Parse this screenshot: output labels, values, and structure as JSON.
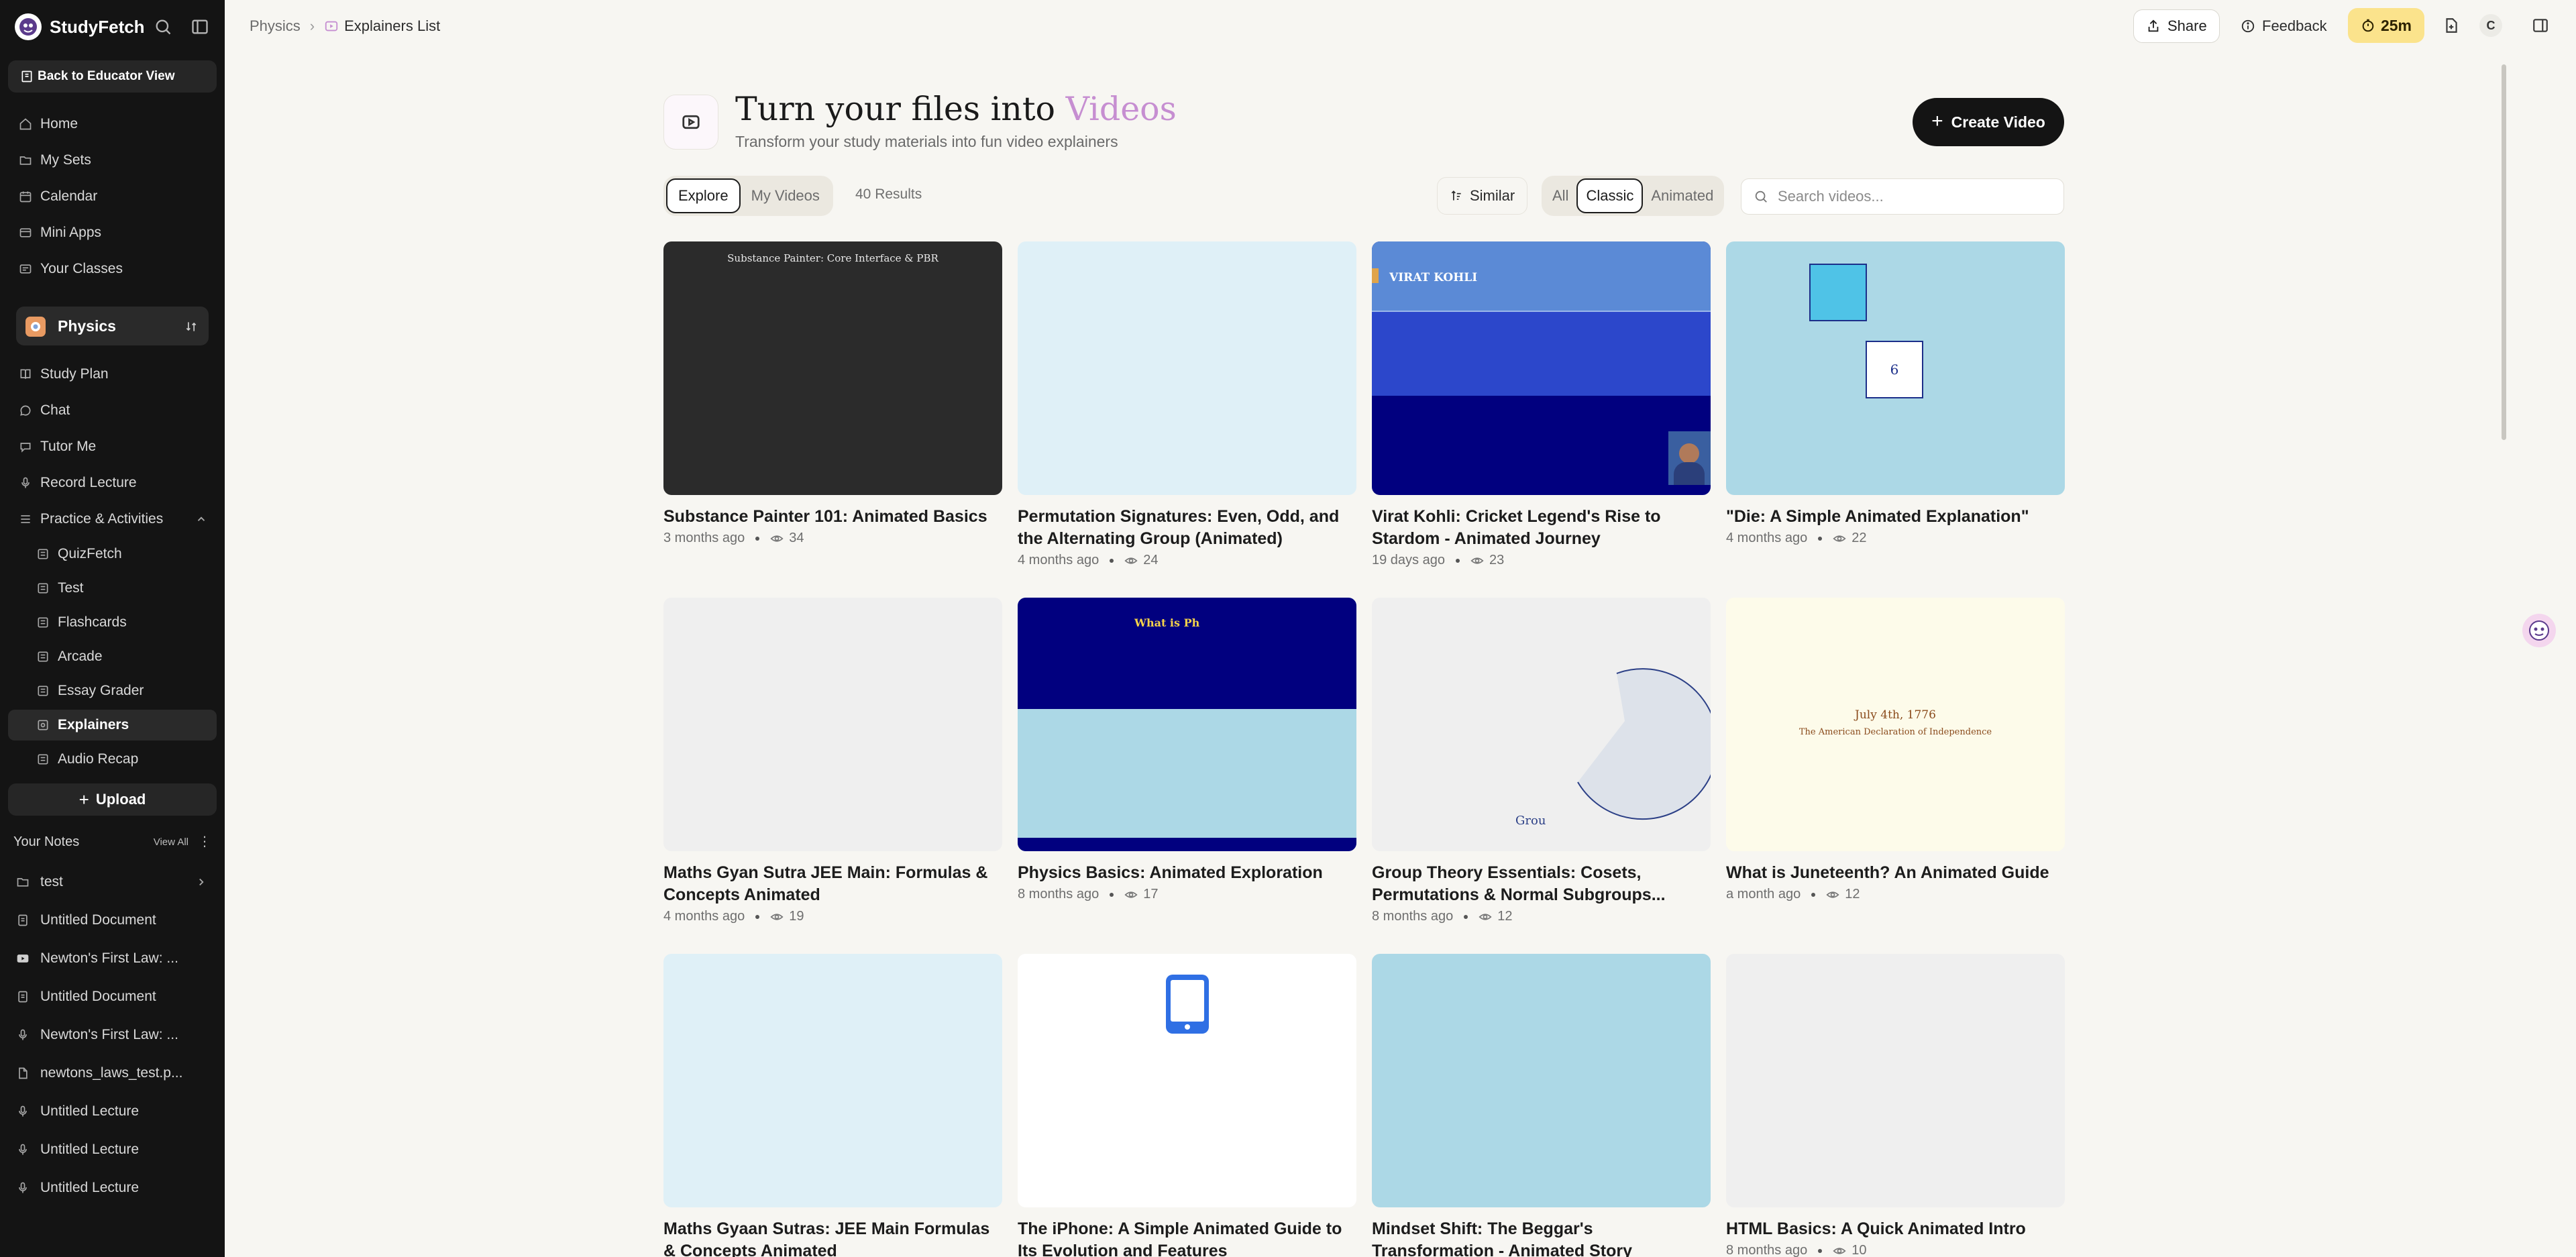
{
  "app": {
    "name": "StudyFetch"
  },
  "sidebar": {
    "back_label": "Back to Educator View",
    "nav": [
      {
        "label": "Home",
        "icon": "home-icon"
      },
      {
        "label": "My Sets",
        "icon": "folder-icon"
      },
      {
        "label": "Calendar",
        "icon": "calendar-icon"
      },
      {
        "label": "Mini Apps",
        "icon": "grid-icon"
      },
      {
        "label": "Your Classes",
        "icon": "layers-icon"
      }
    ],
    "class_name": "Physics",
    "class_nav": [
      {
        "label": "Study Plan",
        "icon": "book-icon"
      },
      {
        "label": "Chat",
        "icon": "chat-icon"
      },
      {
        "label": "Tutor Me",
        "icon": "tutor-icon"
      },
      {
        "label": "Record Lecture",
        "icon": "mic-icon"
      },
      {
        "label": "Practice & Activities",
        "icon": "activities-icon"
      }
    ],
    "practice_items": [
      {
        "label": "QuizFetch",
        "icon": "quiz-icon"
      },
      {
        "label": "Test",
        "icon": "test-icon"
      },
      {
        "label": "Flashcards",
        "icon": "flashcards-icon"
      },
      {
        "label": "Arcade",
        "icon": "arcade-icon"
      },
      {
        "label": "Essay Grader",
        "icon": "essay-icon"
      },
      {
        "label": "Explainers",
        "icon": "explainers-icon",
        "active": true
      },
      {
        "label": "Audio Recap",
        "icon": "audio-icon"
      }
    ],
    "upload_label": "Upload",
    "notes_title": "Your Notes",
    "notes_view_all": "View All",
    "notes": [
      {
        "label": "test",
        "icon": "folder-icon",
        "has_chevron": true
      },
      {
        "label": "Untitled Document",
        "icon": "document-icon"
      },
      {
        "label": "Newton's First Law: ...",
        "icon": "video-icon"
      },
      {
        "label": "Untitled Document",
        "icon": "document-icon"
      },
      {
        "label": "Newton's First Law: ...",
        "icon": "mic-icon"
      },
      {
        "label": "newtons_laws_test.p...",
        "icon": "pdf-icon"
      },
      {
        "label": "Untitled Lecture",
        "icon": "mic-icon"
      },
      {
        "label": "Untitled Lecture",
        "icon": "mic-icon"
      },
      {
        "label": "Untitled Lecture",
        "icon": "mic-icon"
      }
    ]
  },
  "topbar": {
    "breadcrumb": [
      "Physics",
      "Explainers List"
    ],
    "share_label": "Share",
    "feedback_label": "Feedback",
    "timer_label": "25m",
    "avatar_initial": "C"
  },
  "hero": {
    "title_prefix": "Turn your files into",
    "title_accent": "Videos",
    "subtitle": "Transform your study materials into fun video explainers",
    "create_label": "Create Video",
    "accent_color": "#c68ed1"
  },
  "filters": {
    "tabs": [
      {
        "label": "Explore",
        "active": true
      },
      {
        "label": "My Videos",
        "active": false
      }
    ],
    "results": "40 Results",
    "sort_label": "Similar",
    "types": [
      {
        "label": "All",
        "active": false
      },
      {
        "label": "Classic",
        "active": true
      },
      {
        "label": "Animated",
        "active": false
      }
    ],
    "search_placeholder": "Search videos..."
  },
  "videos": [
    {
      "title": "Substance Painter 101: Animated Basics",
      "age": "3 months ago",
      "views": "34",
      "thumb_text": "Substance Painter: Core Interface & PBR"
    },
    {
      "title": "Permutation Signatures: Even, Odd, and the Alternating Group (Animated)",
      "age": "4 months ago",
      "views": "24"
    },
    {
      "title": "Virat Kohli: Cricket Legend's Rise to Stardom - Animated Journey",
      "age": "19 days ago",
      "views": "23",
      "thumb_text": "VIRAT KOHLI"
    },
    {
      "title": "\"Die: A Simple Animated Explanation\"",
      "age": "4 months ago",
      "views": "22",
      "thumb_text": "6"
    },
    {
      "title": "Maths Gyan Sutra JEE Main: Formulas & Concepts Animated",
      "age": "4 months ago",
      "views": "19"
    },
    {
      "title": "Physics Basics: Animated Exploration",
      "age": "8 months ago",
      "views": "17",
      "thumb_text": "What is Ph"
    },
    {
      "title": "Group Theory Essentials: Cosets, Permutations & Normal Subgroups...",
      "age": "8 months ago",
      "views": "12",
      "thumb_text": "Grou"
    },
    {
      "title": "What is Juneteenth? An Animated Guide",
      "age": "a month ago",
      "views": "12",
      "thumb_text": "July 4th, 1776",
      "thumb_text_2": "The American Declaration of Independence"
    },
    {
      "title": "Maths Gyaan Sutras: JEE Main Formulas & Concepts Animated",
      "age": "",
      "views": ""
    },
    {
      "title": "The iPhone: A Simple Animated Guide to Its Evolution and Features",
      "age": "",
      "views": ""
    },
    {
      "title": "Mindset Shift: The Beggar's Transformation - Animated Story",
      "age": "",
      "views": ""
    },
    {
      "title": "HTML Basics: A Quick Animated Intro",
      "age": "8 months ago",
      "views": "10"
    }
  ]
}
